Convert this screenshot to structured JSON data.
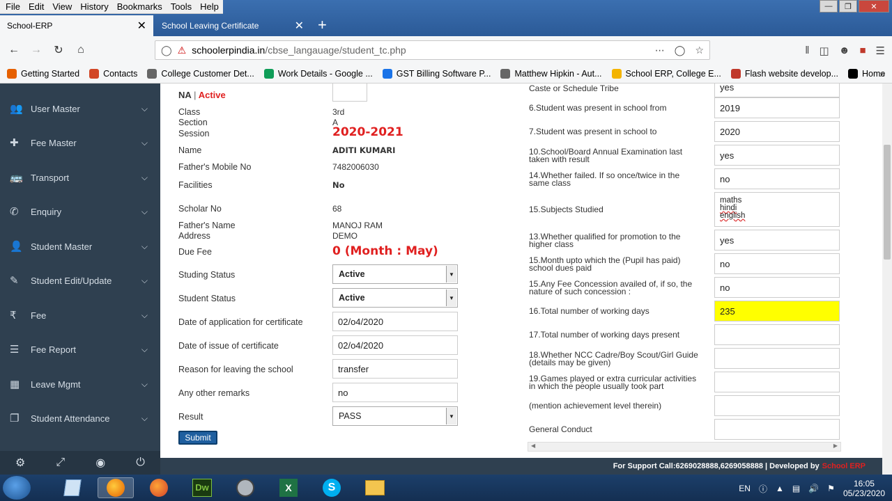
{
  "browser": {
    "menu": [
      "File",
      "Edit",
      "View",
      "History",
      "Bookmarks",
      "Tools",
      "Help"
    ],
    "tabs": [
      {
        "label": "School-ERP"
      },
      {
        "label": "School Leaving Certificate"
      }
    ],
    "url_host": "schoolerpindia.in",
    "url_path": "/cbse_langauage/student_tc.php",
    "bookmarks": [
      {
        "label": "Getting Started",
        "color": "#e66000"
      },
      {
        "label": "Contacts",
        "color": "#d24726"
      },
      {
        "label": "College Customer Det...",
        "color": "#666666"
      },
      {
        "label": "Work Details - Google ...",
        "color": "#0f9d58"
      },
      {
        "label": "GST Billing Software P...",
        "color": "#1a73e8"
      },
      {
        "label": "Matthew Hipkin - Aut...",
        "color": "#666666"
      },
      {
        "label": "School ERP, College E...",
        "color": "#f4b400"
      },
      {
        "label": "Flash website develop...",
        "color": "#c0392b"
      },
      {
        "label": "Home",
        "color": "#000000"
      }
    ]
  },
  "sidebar": {
    "items": [
      {
        "label": "User Master",
        "icon": "users-icon",
        "glyph": "👥"
      },
      {
        "label": "Fee Master",
        "icon": "plus-icon",
        "glyph": "✚"
      },
      {
        "label": "Transport",
        "icon": "bus-icon",
        "glyph": "🚌"
      },
      {
        "label": "Enquiry",
        "icon": "phone-icon",
        "glyph": "✆"
      },
      {
        "label": "Student Master",
        "icon": "user-plus-icon",
        "glyph": "👤"
      },
      {
        "label": "Student Edit/Update",
        "icon": "edit-icon",
        "glyph": "✎"
      },
      {
        "label": "Fee",
        "icon": "rupee-icon",
        "glyph": "₹"
      },
      {
        "label": "Fee Report",
        "icon": "list-icon",
        "glyph": "☰"
      },
      {
        "label": "Leave Mgmt",
        "icon": "grid-icon",
        "glyph": "▦"
      },
      {
        "label": "Student Attendance",
        "icon": "copy-icon",
        "glyph": "❐"
      }
    ]
  },
  "form": {
    "status_prefix": "NA",
    "status_sep": "|",
    "status_active": "Active",
    "class_label": "Class",
    "class_value": "3rd",
    "section_label": "Section",
    "section_value": "A",
    "session_label": "Session",
    "session_value": "2020-2021",
    "name_label": "Name",
    "name_value": "ADITI KUMARI",
    "father_mobile_label": "Father's Mobile No",
    "father_mobile_value": "7482006030",
    "facilities_label": "Facilities",
    "facilities_value": "No",
    "scholar_label": "Scholar No",
    "scholar_value": "68",
    "father_name_label": "Father's Name",
    "father_name_value": "MANOJ RAM",
    "address_label": "Address",
    "address_value": "DEMO",
    "due_fee_label": "Due Fee",
    "due_fee_value": "0 (Month : May)",
    "studing_status_label": "Studing Status",
    "studing_status_value": "Active",
    "student_status_label": "Student Status",
    "student_status_value": "Active",
    "date_app_label": "Date of application for certificate",
    "date_app_value": "02/o4/2020",
    "date_issue_label": "Date of issue of certificate",
    "date_issue_value": "02/o4/2020",
    "reason_label": "Reason for leaving the school",
    "reason_value": "transfer",
    "remarks_label": "Any other remarks",
    "remarks_value": "no",
    "result_label": "Result",
    "result_value": "PASS",
    "submit_label": "Submit"
  },
  "right_form": {
    "caste_label": "Caste or Schedule Tribe",
    "caste_value": "yes",
    "from_label": "6.Student was present in school  from",
    "from_value": "2019",
    "to_label": "7.Student was present in school  to",
    "to_value": "2020",
    "exam_label_1": "10.School/Board Annual Examination last",
    "exam_label_2": "taken with result",
    "exam_value": "yes",
    "failed_label_1": "14.Whether failed. If so once/twice in the",
    "failed_label_2": "same class",
    "failed_value": "no",
    "subjects_label": "15.Subjects Studied",
    "subjects": [
      "maths",
      "hindi",
      "english"
    ],
    "promo_label_1": "13.Whether qualified for promotion to the",
    "promo_label_2": "higher class",
    "promo_value": "yes",
    "month_label_1": "15.Month upto which the (Pupil has paid)",
    "month_label_2": "school dues paid",
    "month_value": "no",
    "concession_label_1": "15.Any Fee Concession availed of, if so, the",
    "concession_label_2": "nature of such concession :",
    "concession_value": "no",
    "working_days_label": "16.Total number of working days",
    "working_days_value": "235",
    "present_days_label": "17.Total number of working days present",
    "present_days_value": "",
    "ncc_label_1": "18.Whether NCC Cadre/Boy Scout/Girl Guide",
    "ncc_label_2": "(details may be given)",
    "ncc_value": "",
    "games_label_1": "19.Games played or extra curricular activities",
    "games_label_2": "in which the people usually took part",
    "games_value": "",
    "achievement_label": "(mention achievement level therein)",
    "achievement_value": "",
    "conduct_label": "General Conduct",
    "conduct_value": ""
  },
  "footer": {
    "support_text": "For Support Call:6269028888,6269058888 | Developed by",
    "brand": "School ERP"
  },
  "taskbar": {
    "lang": "EN",
    "time": "16:05",
    "date": "05/23/2020"
  },
  "colors": {
    "sidebar_bg": "#2f4050",
    "accent_red": "#e02020",
    "highlight_yellow": "#ffff00",
    "submit_blue": "#1f5f9f"
  }
}
